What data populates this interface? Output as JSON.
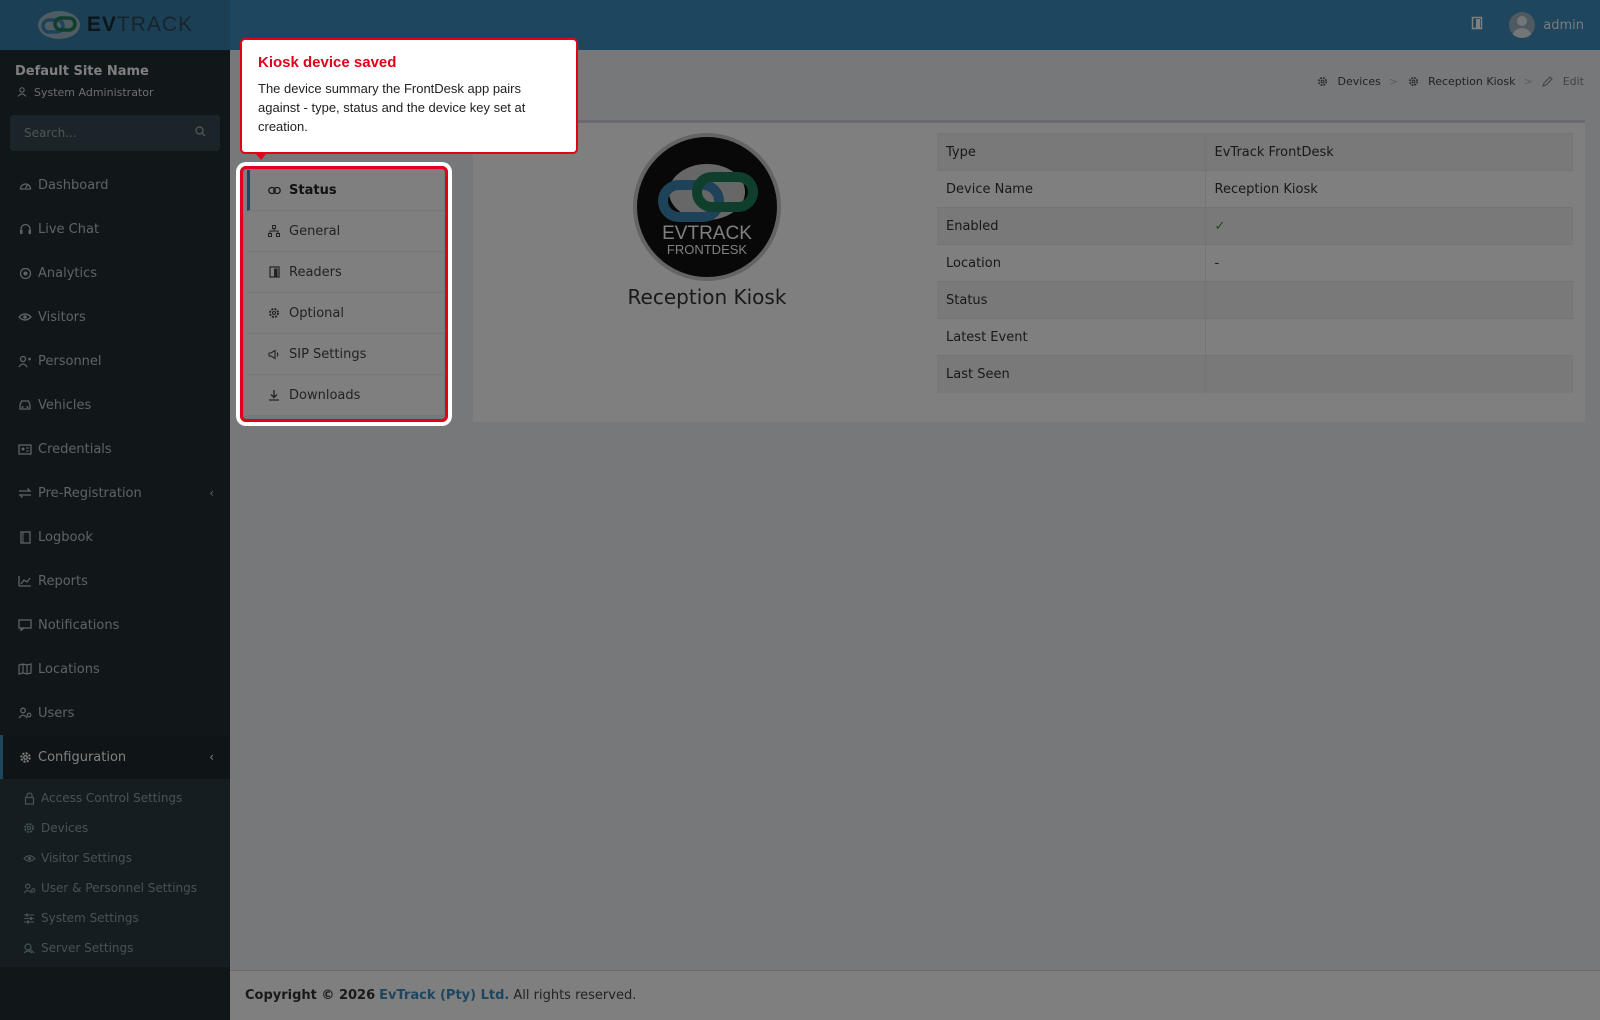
{
  "app": {
    "logo_bold": "EV",
    "logo_rest": "TRACK"
  },
  "header": {
    "username": "admin"
  },
  "sidebar": {
    "site_name": "Default Site Name",
    "role": "System Administrator",
    "search_placeholder": "Search...",
    "items": [
      {
        "label": "Dashboard",
        "icon": "dashboard-icon"
      },
      {
        "label": "Live Chat",
        "icon": "headset-icon"
      },
      {
        "label": "Analytics",
        "icon": "analytics-icon"
      },
      {
        "label": "Visitors",
        "icon": "eye-icon"
      },
      {
        "label": "Personnel",
        "icon": "personnel-icon"
      },
      {
        "label": "Vehicles",
        "icon": "car-icon"
      },
      {
        "label": "Credentials",
        "icon": "id-card-icon"
      },
      {
        "label": "Pre-Registration",
        "icon": "exchange-icon"
      },
      {
        "label": "Logbook",
        "icon": "book-icon"
      },
      {
        "label": "Reports",
        "icon": "chart-icon"
      },
      {
        "label": "Notifications",
        "icon": "message-icon"
      },
      {
        "label": "Locations",
        "icon": "map-icon"
      },
      {
        "label": "Users",
        "icon": "users-icon"
      },
      {
        "label": "Configuration",
        "icon": "gear-icon"
      }
    ],
    "sub_items": [
      {
        "label": "Access Control Settings",
        "icon": "lock-icon"
      },
      {
        "label": "Devices",
        "icon": "gear-icon"
      },
      {
        "label": "Visitor Settings",
        "icon": "eye-icon"
      },
      {
        "label": "User & Personnel Settings",
        "icon": "users-icon"
      },
      {
        "label": "System Settings",
        "icon": "sliders-icon"
      },
      {
        "label": "Server Settings",
        "icon": "server-icon"
      }
    ]
  },
  "breadcrumb": {
    "devices": "Devices",
    "device": "Reception Kiosk",
    "edit": "Edit"
  },
  "tabs": [
    {
      "label": "Status",
      "icon": "link-icon"
    },
    {
      "label": "General",
      "icon": "sitemap-icon"
    },
    {
      "label": "Readers",
      "icon": "door-icon"
    },
    {
      "label": "Optional",
      "icon": "gear-icon"
    },
    {
      "label": "SIP Settings",
      "icon": "megaphone-icon"
    },
    {
      "label": "Downloads",
      "icon": "download-icon"
    }
  ],
  "device": {
    "name": "Reception Kiosk",
    "avatar_text_1": "EVTRACK",
    "avatar_text_2": "FRONTDESK"
  },
  "info_table": [
    {
      "label": "Type",
      "value": "EvTrack FrontDesk"
    },
    {
      "label": "Device Name",
      "value": "Reception Kiosk"
    },
    {
      "label": "Enabled",
      "value": "✓"
    },
    {
      "label": "Location",
      "value": "-"
    },
    {
      "label": "Status",
      "value": ""
    },
    {
      "label": "Latest Event",
      "value": ""
    },
    {
      "label": "Last Seen",
      "value": ""
    }
  ],
  "footer": {
    "copyright": "Copyright © 2026",
    "company": "EvTrack (Pty) Ltd.",
    "rights": "All rights reserved."
  },
  "tour": {
    "title": "Kiosk device saved",
    "body": "The device summary the FrontDesk app pairs against - type, status and the device key set at creation."
  },
  "colors": {
    "accent": "#3c8dbc",
    "sidebar": "#222d32",
    "tour_red": "#e3001b",
    "check_green": "#2e9b3a"
  }
}
